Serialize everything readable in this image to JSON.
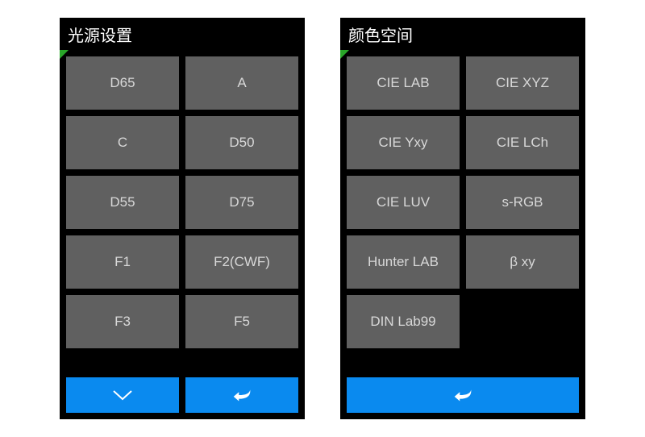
{
  "panels": {
    "light_source": {
      "title": "光源设置",
      "options": [
        "D65",
        "A",
        "C",
        "D50",
        "D55",
        "D75",
        "F1",
        "F2(CWF)",
        "F3",
        "F5"
      ]
    },
    "color_space": {
      "title": "颜色空间",
      "options": [
        "CIE LAB",
        "CIE XYZ",
        "CIE Yxy",
        "CIE LCh",
        "CIE LUV",
        "s-RGB",
        "Hunter LAB",
        "β xy",
        "DIN Lab99"
      ]
    }
  },
  "colors": {
    "accent": "#0a8aef",
    "button_bg": "#606060",
    "indicator": "#29a629"
  },
  "icons": {
    "scroll_down": "chevron-down",
    "back": "back-arrow"
  }
}
